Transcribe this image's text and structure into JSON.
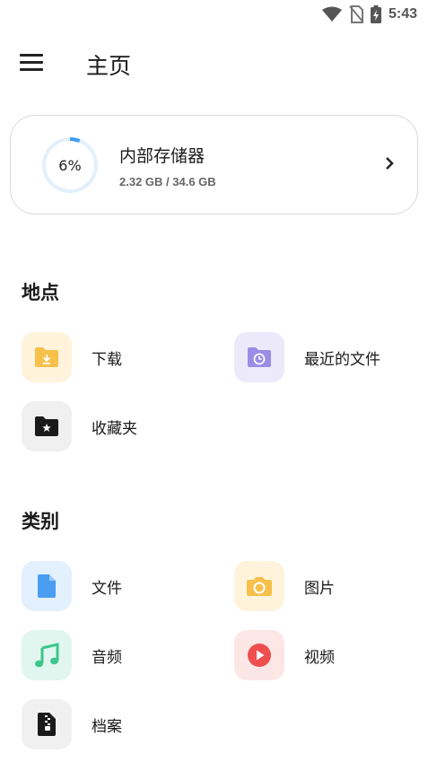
{
  "status_bar": {
    "time": "5:43"
  },
  "header": {
    "title": "主页"
  },
  "storage": {
    "percent_label": "6%",
    "percent_used": 6,
    "name": "内部存储器",
    "size": "2.32 GB / 34.6 GB",
    "ring_color": "#3d9bf5",
    "ring_track_color": "#e3f0fc"
  },
  "places": {
    "title": "地点",
    "items": [
      {
        "label": "下载",
        "icon": "download-folder-icon"
      },
      {
        "label": "最近的文件",
        "icon": "recent-folder-icon"
      },
      {
        "label": "收藏夹",
        "icon": "starred-folder-icon"
      }
    ]
  },
  "categories": {
    "title": "类别",
    "items": [
      {
        "label": "文件",
        "icon": "document-icon"
      },
      {
        "label": "图片",
        "icon": "camera-icon"
      },
      {
        "label": "音频",
        "icon": "music-note-icon"
      },
      {
        "label": "视频",
        "icon": "play-icon"
      },
      {
        "label": "档案",
        "icon": "archive-icon"
      }
    ]
  }
}
